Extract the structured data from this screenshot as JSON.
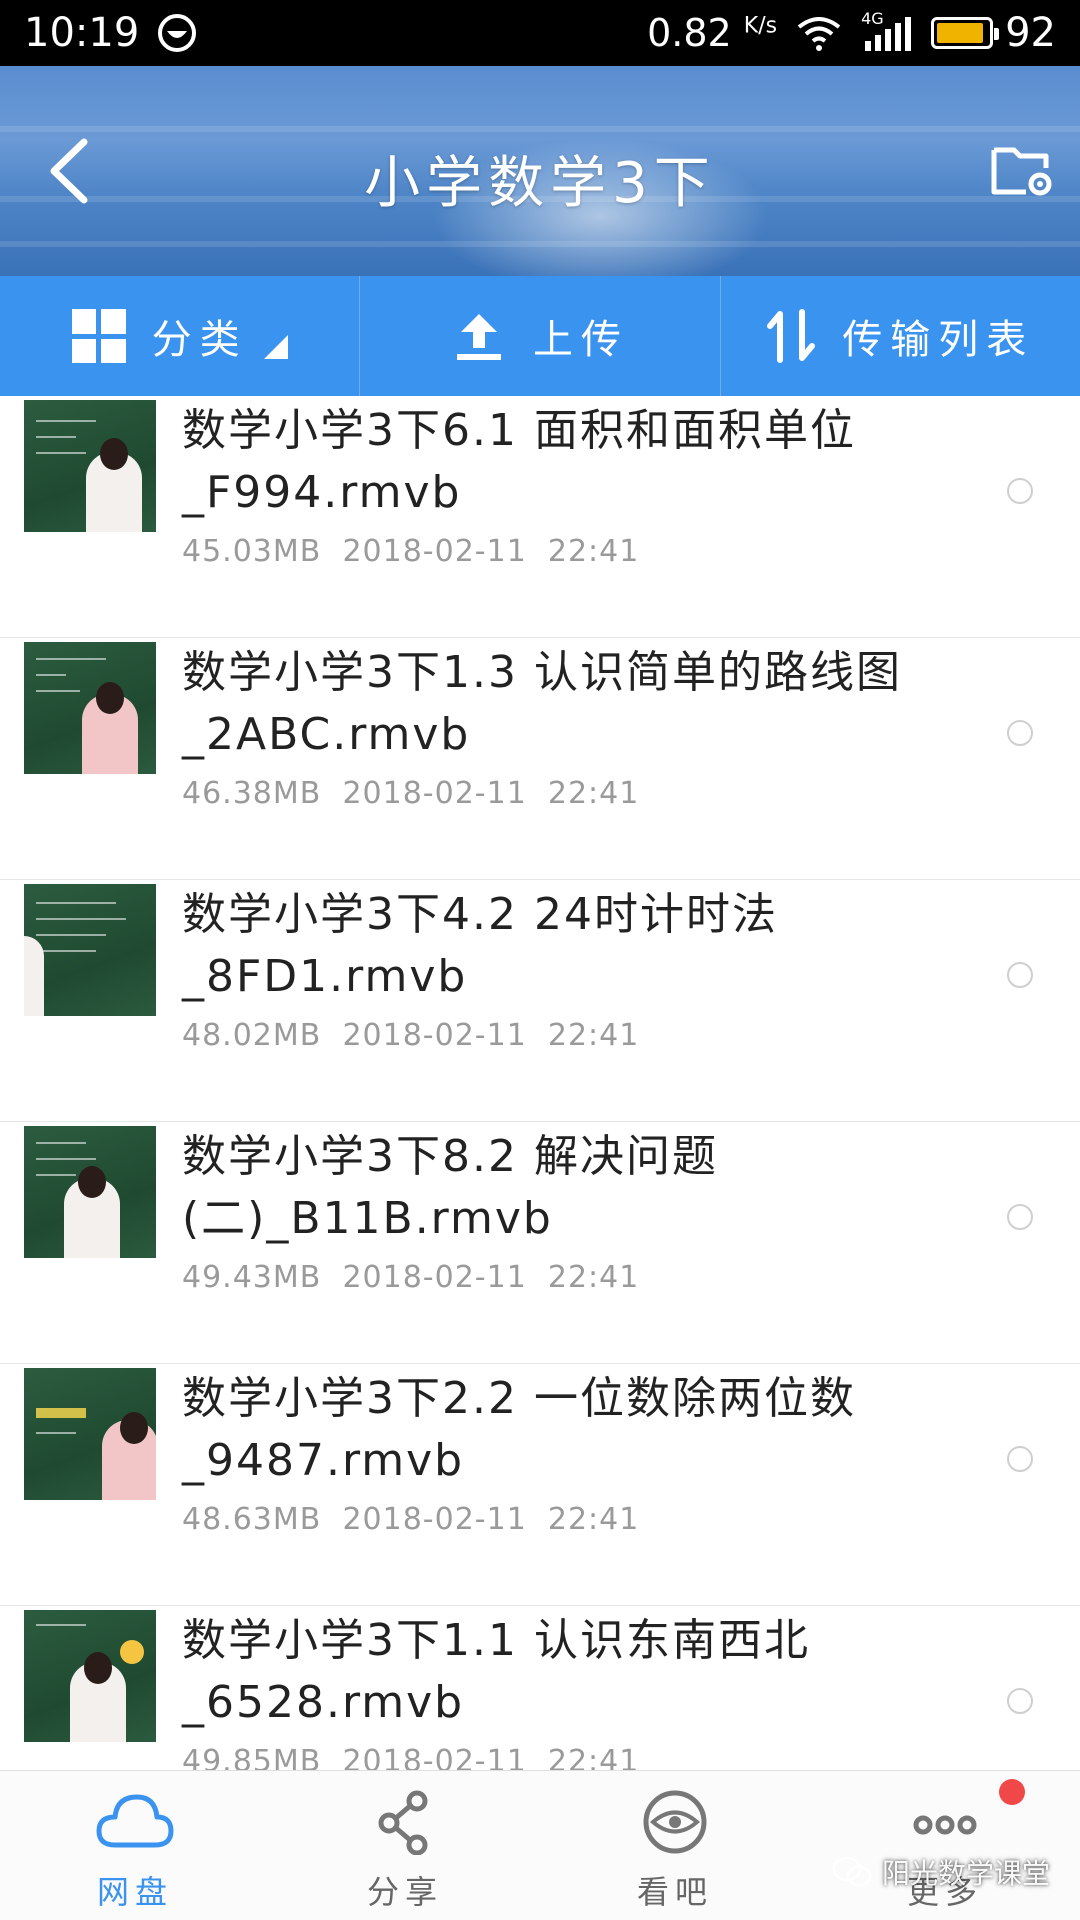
{
  "status_bar": {
    "time": "10:19",
    "speed": "0.82",
    "speed_unit": "K/s",
    "network": "4G",
    "battery": "92",
    "battery_level": 0.92
  },
  "header": {
    "title": "小学数学3下",
    "back_icon": "chevron-left-icon",
    "folder_icon": "folder-settings-icon"
  },
  "toolbar": {
    "category_label": "分类",
    "upload_label": "上传",
    "transfer_label": "传输列表"
  },
  "files": [
    {
      "name": "数学小学3下6.1 面积和面积单位_F994.rmvb",
      "size": "45.03MB",
      "date": "2018-02-11",
      "time": "22:41"
    },
    {
      "name": "数学小学3下1.3 认识简单的路线图_2ABC.rmvb",
      "size": "46.38MB",
      "date": "2018-02-11",
      "time": "22:41"
    },
    {
      "name": "数学小学3下4.2 24时计时法_8FD1.rmvb",
      "size": "48.02MB",
      "date": "2018-02-11",
      "time": "22:41"
    },
    {
      "name": "数学小学3下8.2 解决问题(二)_B11B.rmvb",
      "size": "49.43MB",
      "date": "2018-02-11",
      "time": "22:41"
    },
    {
      "name": "数学小学3下2.2 一位数除两位数_9487.rmvb",
      "size": "48.63MB",
      "date": "2018-02-11",
      "time": "22:41"
    },
    {
      "name": "数学小学3下1.1 认识东南西北_6528.rmvb",
      "size": "49.85MB",
      "date": "2018-02-11",
      "time": "22:41"
    }
  ],
  "bottom_nav": [
    {
      "label": "网盘",
      "icon": "cloud-icon",
      "active": true
    },
    {
      "label": "分享",
      "icon": "share-icon",
      "active": false
    },
    {
      "label": "看吧",
      "icon": "eye-icon",
      "active": false
    },
    {
      "label": "更多",
      "icon": "more-icon",
      "active": false
    }
  ],
  "watermark": "阳光数学课堂",
  "colors": {
    "accent": "#3b93f0",
    "status_bar": "#000000",
    "notification_dot": "#f04848",
    "battery": "#f0b400"
  }
}
